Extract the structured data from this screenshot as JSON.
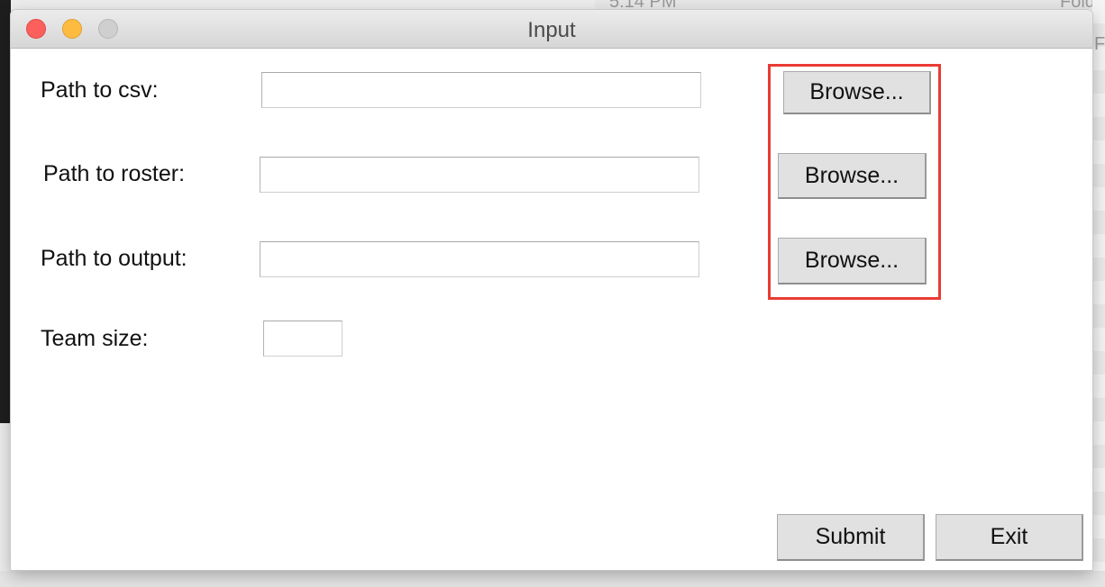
{
  "background": {
    "menubar_time": "5:14 PM",
    "folder_label": "Folde",
    "folder_label_2": "Fold"
  },
  "window": {
    "title": "Input",
    "controls": [
      "close",
      "minimize",
      "zoom"
    ]
  },
  "form": {
    "csv": {
      "label": "Path to csv:",
      "value": "",
      "browse_label": "Browse..."
    },
    "roster": {
      "label": "Path to roster:",
      "value": "",
      "browse_label": "Browse..."
    },
    "output": {
      "label": "Path to output:",
      "value": "",
      "browse_label": "Browse..."
    },
    "team_size": {
      "label": "Team size:",
      "value": ""
    }
  },
  "footer": {
    "submit_label": "Submit",
    "exit_label": "Exit"
  },
  "colors": {
    "annotation_box": "#ea3b33",
    "close_light": "#fc605c",
    "minimize_light": "#fdbc40",
    "zoom_light": "#cfcfcf"
  }
}
